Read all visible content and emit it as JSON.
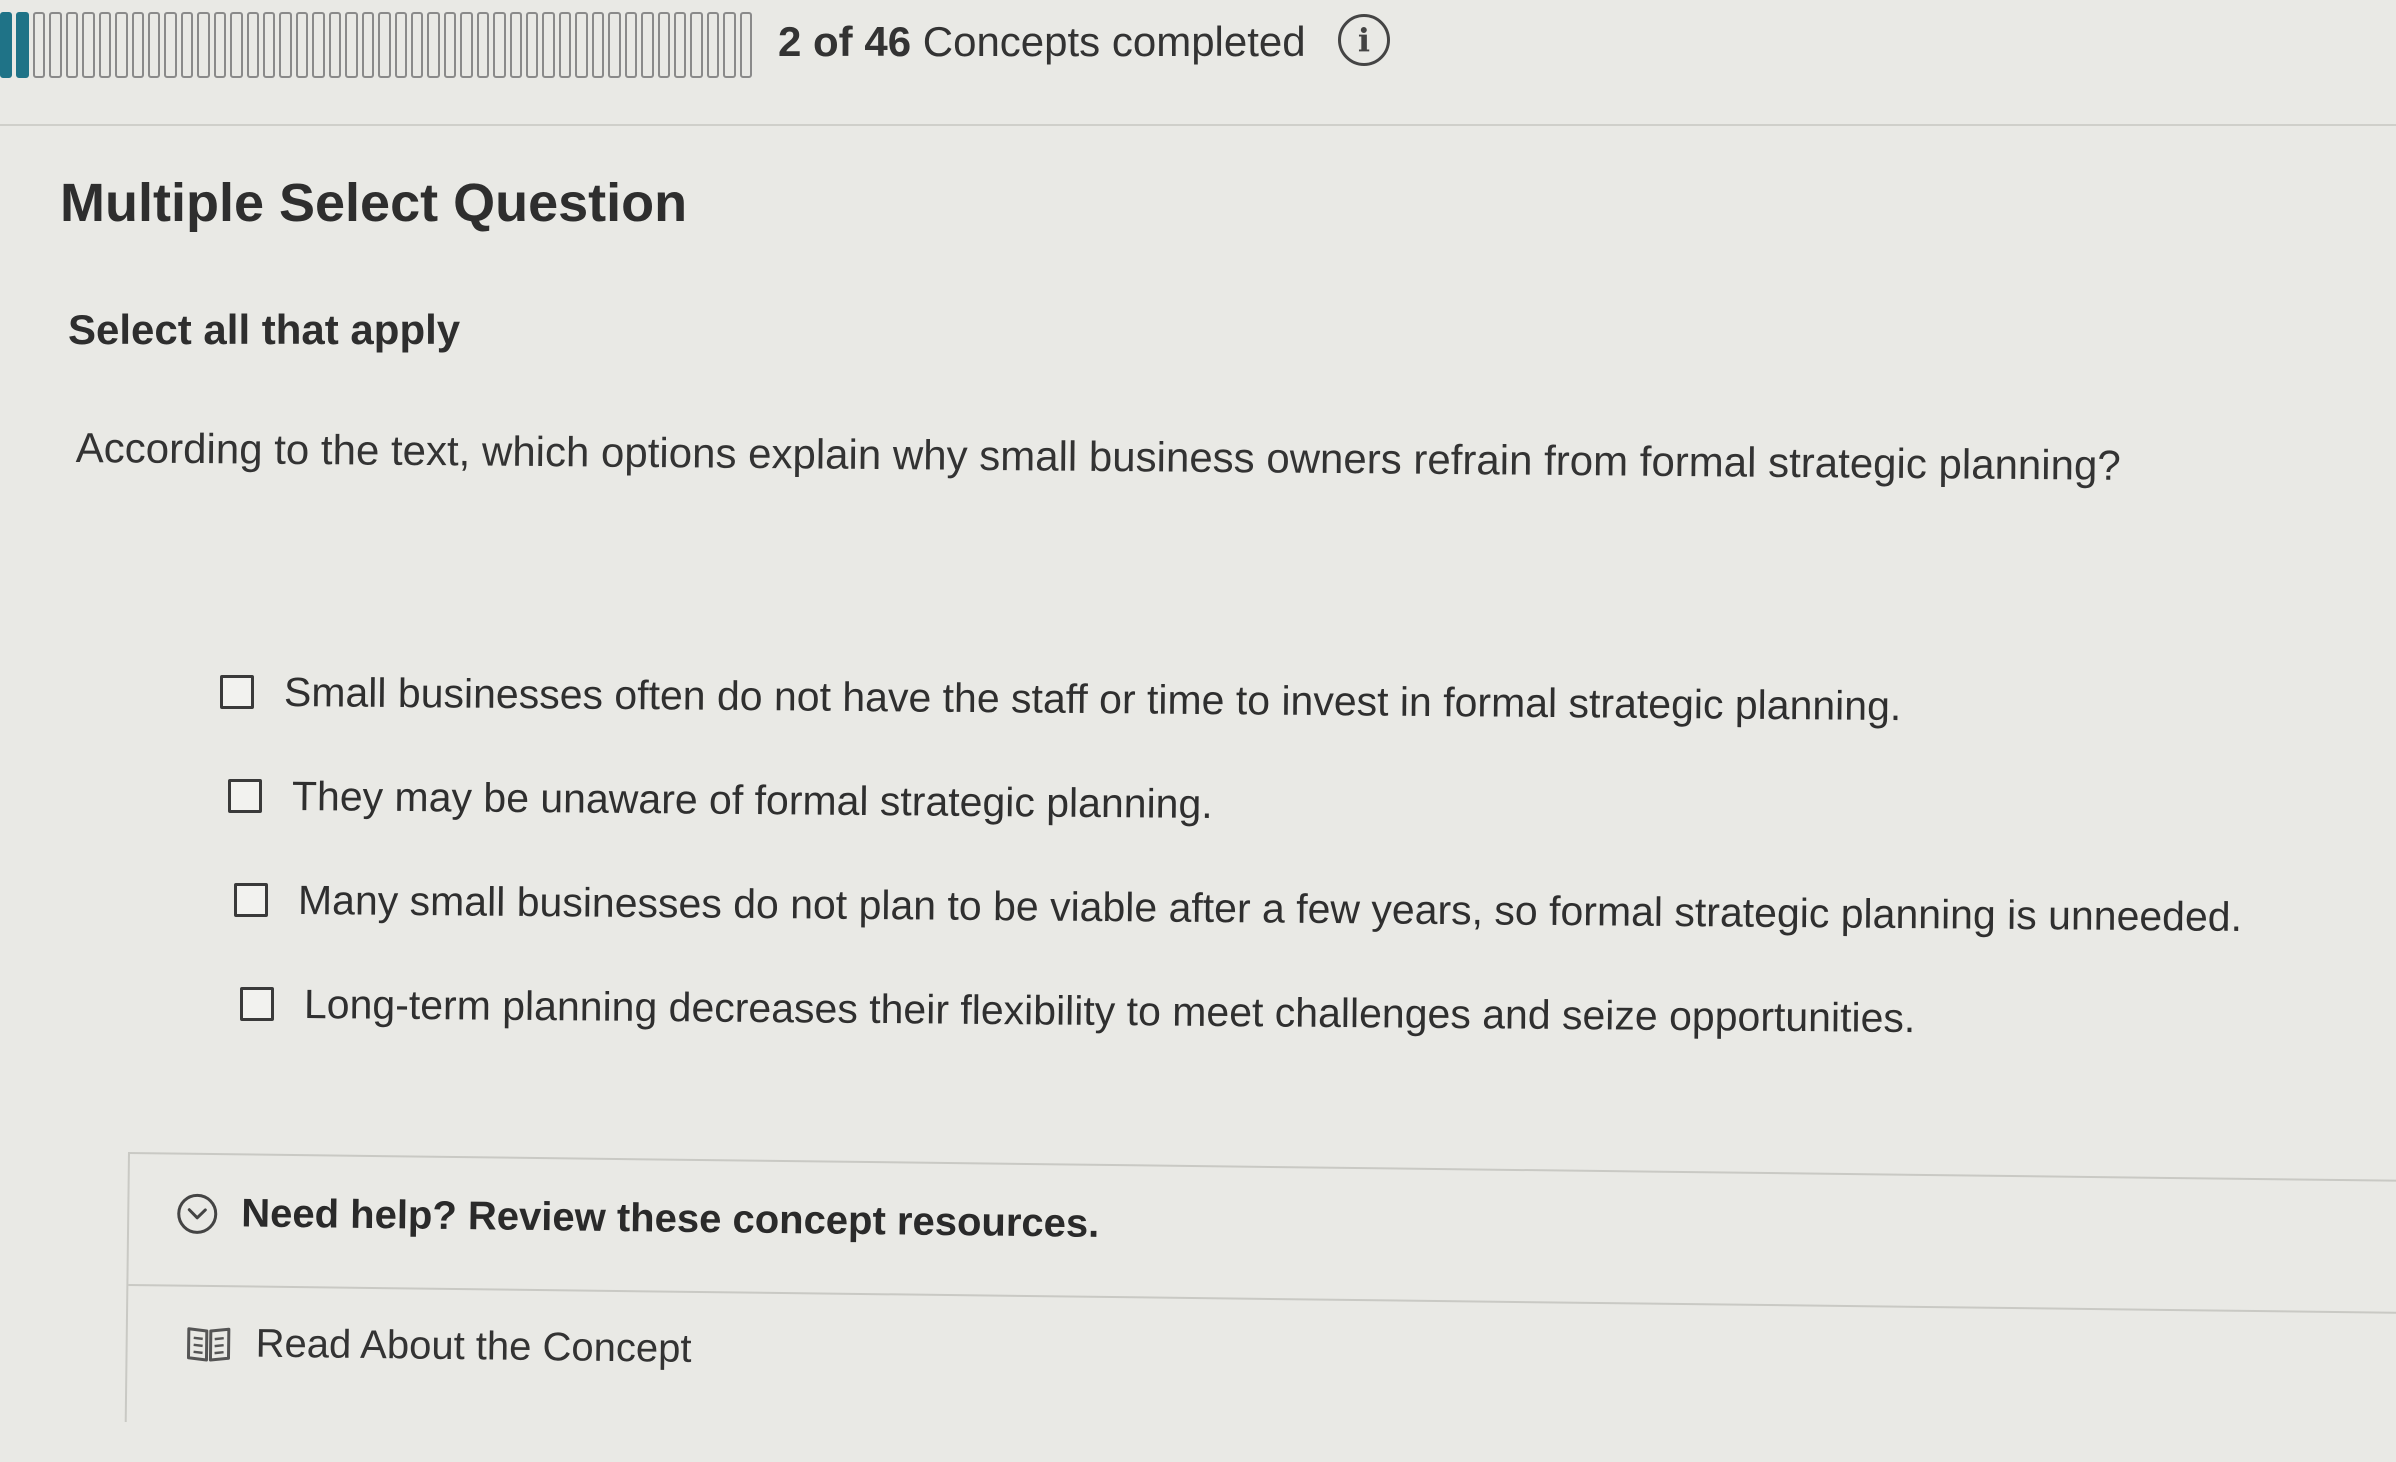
{
  "progress": {
    "completed": "2",
    "of_label": "of",
    "total": "46",
    "suffix": "Concepts completed",
    "completed_count": 2,
    "total_count": 46,
    "fill_color": "#1f7387"
  },
  "question": {
    "type_label": "Multiple Select Question",
    "instruction": "Select all that apply",
    "prompt": "According to the text, which options explain why small business owners refrain from formal strategic planning?",
    "options": [
      {
        "label": "Small businesses often do not have the staff or time to invest in formal strategic planning.",
        "checked": false
      },
      {
        "label": "They may be unaware of formal strategic planning.",
        "checked": false
      },
      {
        "label": "Many small businesses do not plan to be viable after a few years, so formal strategic planning is unneeded.",
        "checked": false
      },
      {
        "label": "Long-term planning decreases their flexibility to meet challenges and seize opportunities.",
        "checked": false
      }
    ]
  },
  "help": {
    "title": "Need help? Review these concept resources.",
    "icon": "chevron-down-circle-icon",
    "resources": [
      {
        "label": "Read About the Concept",
        "icon": "book-icon"
      }
    ]
  }
}
